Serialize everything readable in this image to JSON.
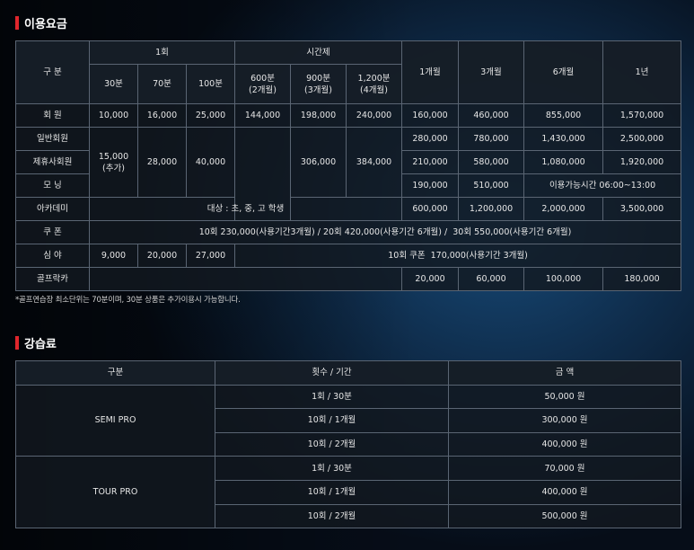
{
  "fees": {
    "title": "이용요금",
    "group_headers": {
      "category": "구 분",
      "single": "1회",
      "timed": "시간제"
    },
    "sub_headers": {
      "single": [
        "30분",
        "70분",
        "100분"
      ],
      "timed": [
        [
          "600분",
          "(2개월)"
        ],
        [
          "900분",
          "(3개월)"
        ],
        [
          "1,200분",
          "(4개월)"
        ]
      ],
      "periods": [
        "1개월",
        "3개월",
        "6개월",
        "1년"
      ]
    },
    "rows": {
      "member": {
        "label": "회 원",
        "single": [
          "10,000",
          "16,000",
          "25,000"
        ],
        "timed": [
          "144,000",
          "198,000",
          "240,000"
        ],
        "periods": [
          "160,000",
          "460,000",
          "855,000",
          "1,570,000"
        ]
      },
      "general": {
        "label": "일반회원",
        "periods": [
          "280,000",
          "780,000",
          "1,430,000",
          "2,500,000"
        ]
      },
      "partner": {
        "label": "제휴사회원",
        "periods": [
          "210,000",
          "580,000",
          "1,080,000",
          "1,920,000"
        ]
      },
      "morning": {
        "label": "모 닝",
        "periods": [
          "190,000",
          "510,000"
        ],
        "hours_note": "이용가능시간 06:00~13:00"
      },
      "merged": {
        "single": [
          "15,000",
          "(추가)",
          "28,000",
          "40,000"
        ],
        "timed": [
          "306,000",
          "384,000"
        ]
      },
      "academy": {
        "label": "아카데미",
        "target": "대상 : 초, 중, 고 학생",
        "periods": [
          "600,000",
          "1,200,000",
          "2,000,000",
          "3,500,000"
        ]
      },
      "coupon": {
        "label": "쿠 폰",
        "text": "10회 230,000(사용기간3개월) / 20회 420,000(사용기간 6개월) /  30회 550,000(사용기간 6개월)"
      },
      "night": {
        "label": "심 야",
        "single": [
          "9,000",
          "20,000",
          "27,000"
        ],
        "text": "10회 쿠폰  170,000(사용기간 3개월)"
      },
      "golf_cart": {
        "label": "골프락카",
        "periods": [
          "20,000",
          "60,000",
          "100,000",
          "180,000"
        ]
      }
    },
    "note": "*골프연습장 최소단위는 70분이며, 30분 상품은 추가이용시 가능합니다."
  },
  "lessons": {
    "title": "강습료",
    "headers": [
      "구분",
      "횟수 / 기간",
      "금 액"
    ],
    "groups": [
      {
        "name": "SEMI PRO",
        "rows": [
          [
            "1회 / 30분",
            "50,000 원"
          ],
          [
            "10회 / 1개월",
            "300,000 원"
          ],
          [
            "10회 / 2개월",
            "400,000 원"
          ]
        ]
      },
      {
        "name": "TOUR PRO",
        "rows": [
          [
            "1회 / 30분",
            "70,000 원"
          ],
          [
            "10회 / 1개월",
            "400,000 원"
          ],
          [
            "10회 / 2개월",
            "500,000 원"
          ]
        ]
      }
    ]
  }
}
